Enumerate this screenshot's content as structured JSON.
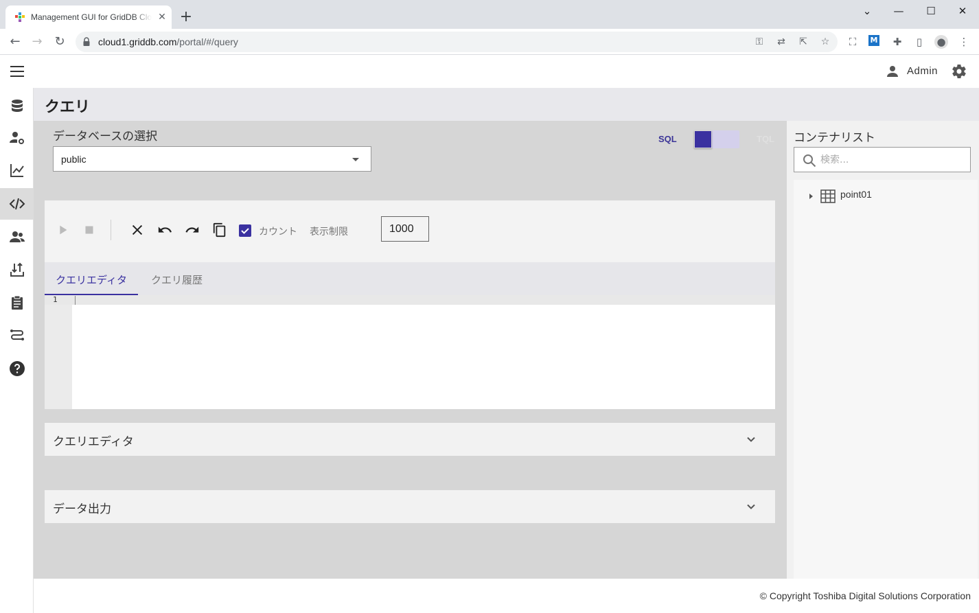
{
  "browser": {
    "tab_title": "Management GUI for GridDB Cloud",
    "tab_close": "✕",
    "new_tab": "+",
    "window_controls": {
      "minimize": "—",
      "maximize": "☐",
      "close": "✕",
      "tab_search": "⌄"
    },
    "url_host": "cloud1.griddb.com",
    "url_path": "/portal/#/query"
  },
  "header": {
    "user_name": "Admin"
  },
  "sidebar": {
    "items": [
      {
        "name": "database",
        "active": false
      },
      {
        "name": "user-settings",
        "active": false
      },
      {
        "name": "chart",
        "active": false
      },
      {
        "name": "query",
        "active": true
      },
      {
        "name": "users",
        "active": false
      },
      {
        "name": "import-export",
        "active": false
      },
      {
        "name": "clipboard",
        "active": false
      },
      {
        "name": "connections",
        "active": false
      },
      {
        "name": "help",
        "active": false
      }
    ]
  },
  "page": {
    "title": "クエリ"
  },
  "db_select": {
    "label": "データベースの選択",
    "value": "public"
  },
  "mode": {
    "sql": "SQL",
    "tql": "TQL",
    "selected": "SQL"
  },
  "editor": {
    "count_label": "カウント",
    "count_checked": true,
    "limit_label": "表示制限",
    "limit_value": "1000",
    "tabs": [
      {
        "label": "クエリエディタ",
        "active": true
      },
      {
        "label": "クエリ履歴",
        "active": false
      }
    ],
    "line_number": "1"
  },
  "panels": [
    {
      "title": "クエリエディタ"
    },
    {
      "title": "データ出力"
    }
  ],
  "container_list": {
    "title": "コンテナリスト",
    "search_placeholder": "検索...",
    "items": [
      {
        "label": "point01"
      }
    ]
  },
  "footer": {
    "text": "© Copyright Toshiba Digital Solutions Corporation"
  },
  "colors": {
    "accent": "#3a31a0",
    "main_bg": "#d6d6d6",
    "title_bar_bg": "#e8e8ec"
  }
}
